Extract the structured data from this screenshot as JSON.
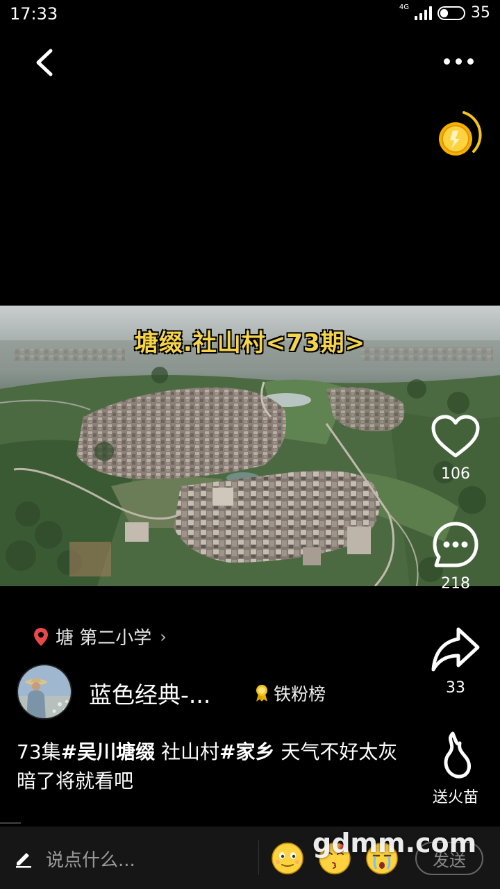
{
  "status_bar": {
    "time": "17:33",
    "network": "4G",
    "battery_level": "35"
  },
  "video": {
    "title_overlay": "塘缀.社山村<73期>"
  },
  "actions": {
    "like_count": "106",
    "comment_count": "218",
    "share_count": "33",
    "fire_label": "送火苗"
  },
  "location": {
    "text": "塘 第二小学"
  },
  "author": {
    "name": "蓝色经典-...",
    "badge_label": "铁粉榜"
  },
  "caption": {
    "part1": "73集",
    "tag1": "#吴川塘缀",
    "part2": "  社山村",
    "tag2": "#家乡",
    "part3": "  天气不好太灰暗了将就看吧"
  },
  "comment_bar": {
    "placeholder": "说点什么...",
    "send_label": "发送"
  },
  "watermark": "gdmm.com",
  "colors": {
    "background": "#000000",
    "title_yellow": "#f6d44a",
    "coin_gold": "#f5c518",
    "location_pin": "#e8484a"
  },
  "icons": [
    "back-arrow-icon",
    "more-dots-icon",
    "coin-icon",
    "heart-icon",
    "comment-bubble-icon",
    "share-arrow-icon",
    "fire-sprout-icon",
    "location-pin-icon",
    "medal-icon",
    "pencil-icon",
    "smile-emoji-icon",
    "kiss-emoji-icon",
    "cry-emoji-icon"
  ]
}
